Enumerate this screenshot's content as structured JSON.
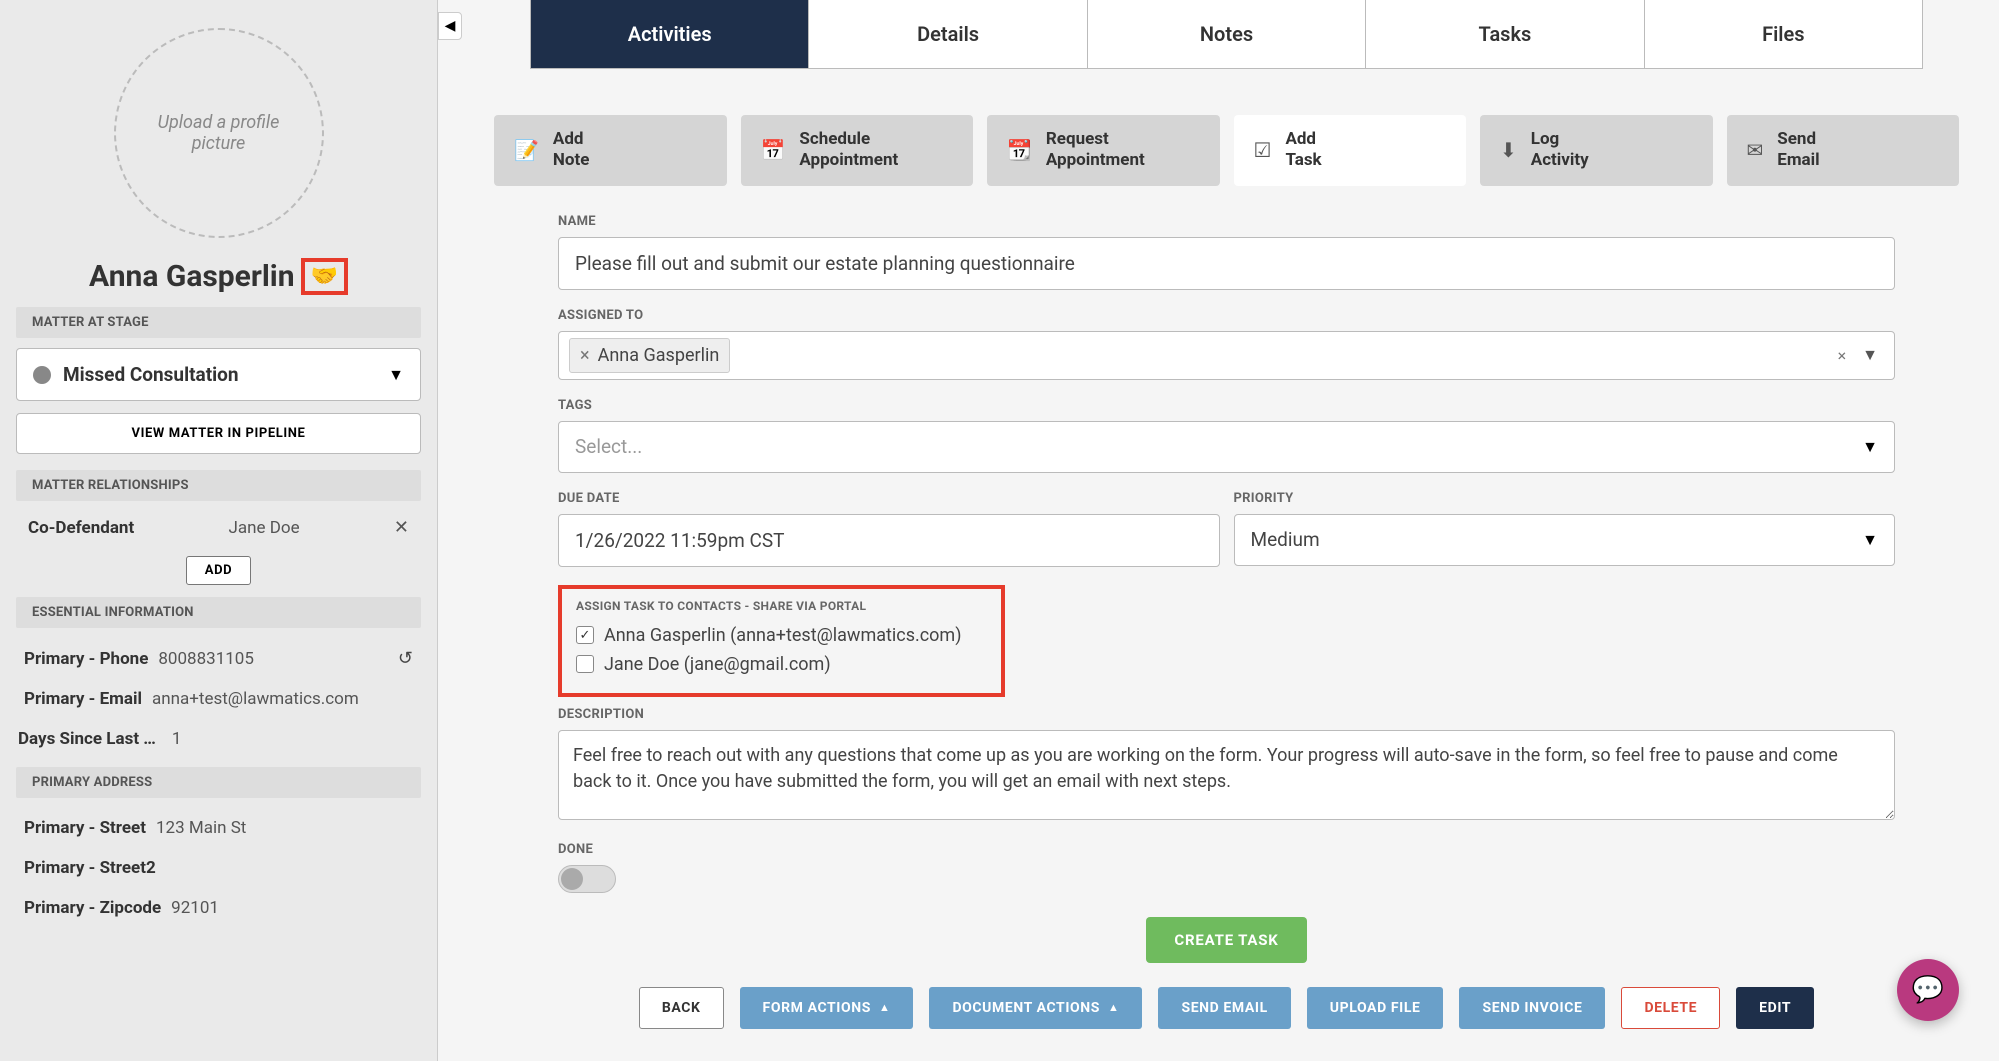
{
  "sidebar": {
    "avatar_placeholder": "Upload a profile picture",
    "contact_name": "Anna Gasperlin",
    "stage_section": "MATTER AT STAGE",
    "stage_value": "Missed Consultation",
    "view_pipeline": "VIEW MATTER IN PIPELINE",
    "relationships_section": "MATTER RELATIONSHIPS",
    "relationship_label": "Co-Defendant",
    "relationship_value": "Jane  Doe",
    "add_btn": "ADD",
    "essential_section": "ESSENTIAL INFORMATION",
    "phone_label": "Primary - Phone",
    "phone_value": "8008831105",
    "email_label": "Primary - Email",
    "email_value": "anna+test@lawmatics.com",
    "days_label": "Days Since Last …",
    "days_value": "1",
    "address_section": "PRIMARY ADDRESS",
    "street_label": "Primary - Street",
    "street_value": "123 Main St",
    "street2_label": "Primary - Street2",
    "street2_value": "",
    "zip_label": "Primary - Zipcode",
    "zip_value": "92101"
  },
  "tabs": {
    "activities": "Activities",
    "details": "Details",
    "notes": "Notes",
    "tasks": "Tasks",
    "files": "Files"
  },
  "actions": {
    "add_note": "Add\nNote",
    "schedule_appt": "Schedule\nAppointment",
    "request_appt": "Request\nAppointment",
    "add_task": "Add\nTask",
    "log_activity": "Log\nActivity",
    "send_email": "Send\nEmail"
  },
  "form": {
    "name_label": "NAME",
    "name_value": "Please fill out and submit our estate planning questionnaire",
    "assigned_label": "ASSIGNED TO",
    "assigned_chip": "Anna Gasperlin",
    "tags_label": "TAGS",
    "tags_placeholder": "Select...",
    "due_label": "DUE DATE",
    "due_value": "1/26/2022 11:59pm CST",
    "priority_label": "PRIORITY",
    "priority_value": "Medium",
    "portal_label": "ASSIGN TASK TO CONTACTS - SHARE VIA PORTAL",
    "portal_contact1": "Anna Gasperlin (anna+test@lawmatics.com)",
    "portal_contact2": "Jane Doe (jane@gmail.com)",
    "description_label": "DESCRIPTION",
    "description_value": "Feel free to reach out with any questions that come up as you are working on the form. Your progress will auto-save in the form, so feel free to pause and come back to it. Once you have submitted the form, you will get an email with next steps.",
    "done_label": "DONE",
    "create_btn": "CREATE TASK"
  },
  "bottom": {
    "back": "BACK",
    "form_actions": "FORM ACTIONS",
    "document_actions": "DOCUMENT ACTIONS",
    "send_email": "SEND EMAIL",
    "upload_file": "UPLOAD FILE",
    "send_invoice": "SEND INVOICE",
    "delete": "DELETE",
    "edit": "EDIT"
  }
}
